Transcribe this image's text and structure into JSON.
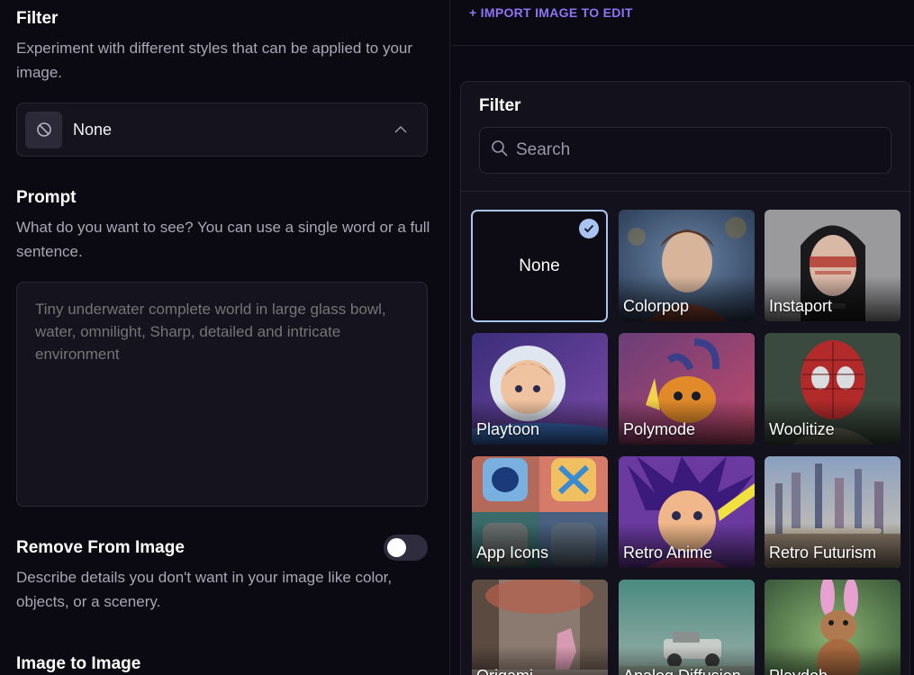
{
  "left": {
    "filter": {
      "title": "Filter",
      "description": "Experiment with different styles that can be applied to your image.",
      "selected": "None",
      "icon": "ban-icon"
    },
    "prompt": {
      "title": "Prompt",
      "description": "What do you want to see? You can use a single word or a full sentence.",
      "placeholder": "Tiny underwater complete world in large glass bowl, water, omnilight, Sharp, detailed and intricate environment"
    },
    "remove": {
      "title": "Remove From Image",
      "description": "Describe details you don't want in your image like color, objects, or a scenery.",
      "toggle_on": false
    },
    "img2img": {
      "title": "Image to Image"
    }
  },
  "header": {
    "import_label": "+ IMPORT IMAGE TO EDIT"
  },
  "panel": {
    "title": "Filter",
    "search_placeholder": "Search",
    "tiles": [
      {
        "label": "None",
        "selected": true
      },
      {
        "label": "Colorpop"
      },
      {
        "label": "Instaport"
      },
      {
        "label": "Playtoon"
      },
      {
        "label": "Polymode"
      },
      {
        "label": "Woolitize"
      },
      {
        "label": "App Icons"
      },
      {
        "label": "Retro Anime"
      },
      {
        "label": "Retro Futurism"
      },
      {
        "label": "Origami"
      },
      {
        "label": "Analog Diffusion"
      },
      {
        "label": "Playdoh"
      }
    ]
  },
  "colors": {
    "accent": "#8f74f5",
    "selected_border": "#a9c4ef",
    "background": "#0c0a14"
  }
}
